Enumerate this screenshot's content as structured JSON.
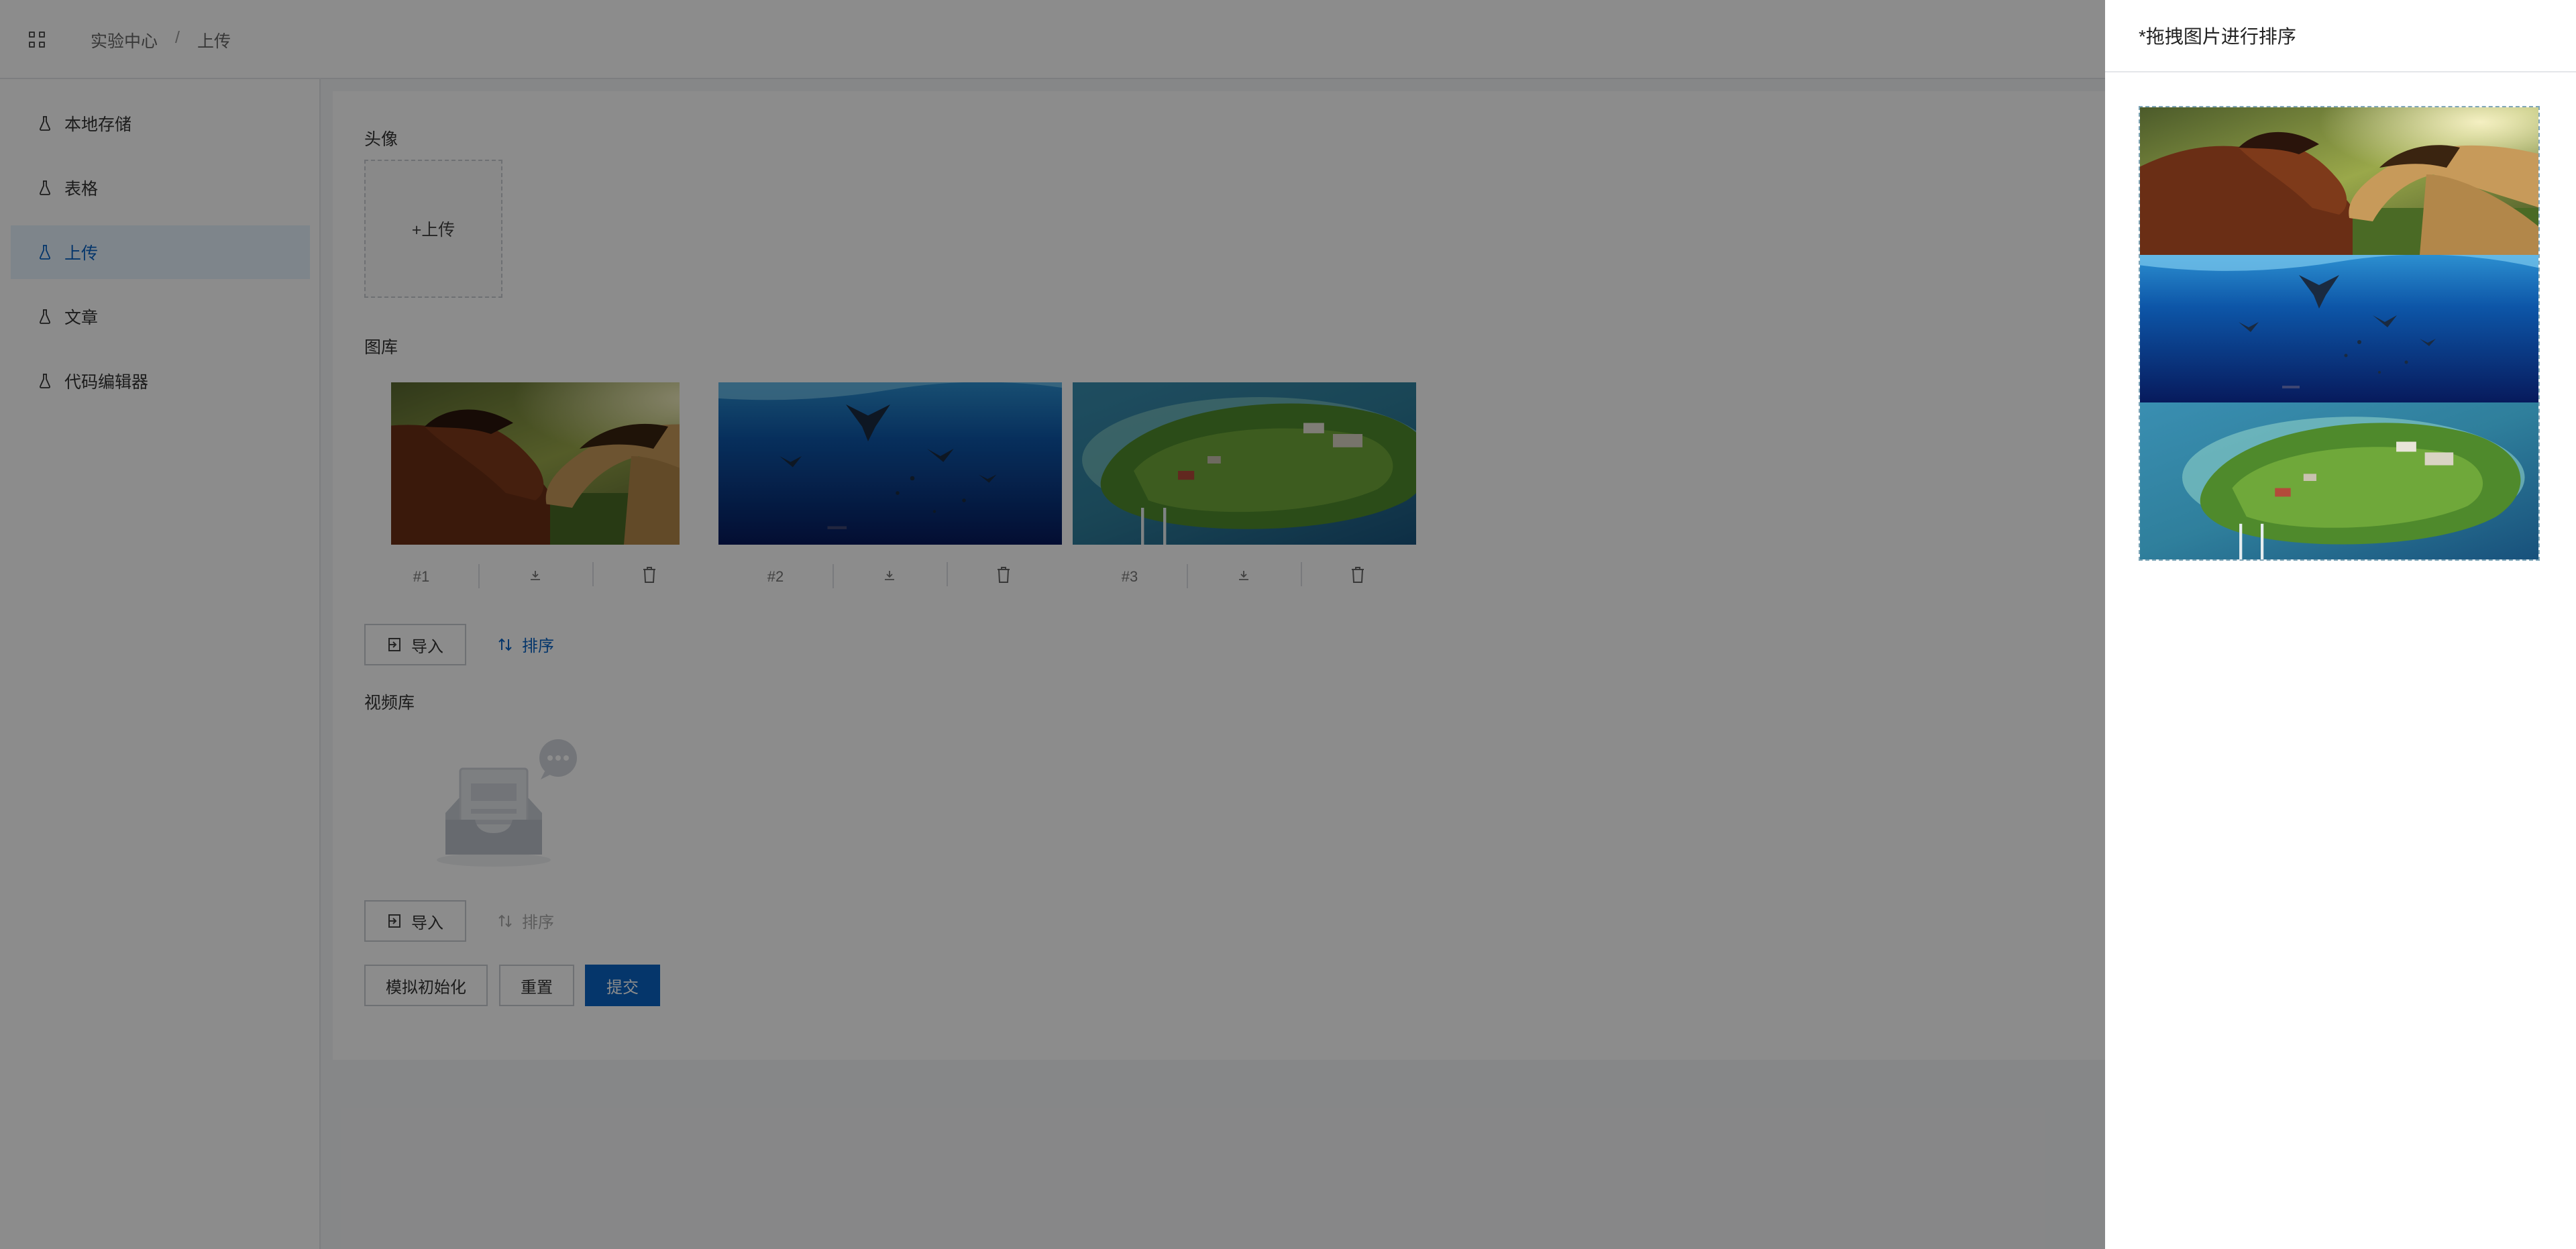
{
  "breadcrumb": {
    "root": "实验中心",
    "separator": "/",
    "current": "上传"
  },
  "sidebar": {
    "items": [
      {
        "label": "本地存储",
        "active": false
      },
      {
        "label": "表格",
        "active": false
      },
      {
        "label": "上传",
        "active": true
      },
      {
        "label": "文章",
        "active": false
      },
      {
        "label": "代码编辑器",
        "active": false
      }
    ]
  },
  "form": {
    "avatar": {
      "label": "头像",
      "upload_text": "+上传"
    },
    "gallery": {
      "label": "图库",
      "images": [
        {
          "index": "#1",
          "subject": "horses"
        },
        {
          "index": "#2",
          "subject": "manta-rays-underwater"
        },
        {
          "index": "#3",
          "subject": "aerial-island"
        }
      ],
      "import_label": "导入",
      "sort_label": "排序"
    },
    "video": {
      "label": "视频库",
      "import_label": "导入",
      "sort_label": "排序"
    },
    "buttons": {
      "mock_init": "模拟初始化",
      "reset": "重置",
      "submit": "提交"
    }
  },
  "drawer": {
    "title": "*拖拽图片进行排序",
    "items": [
      "horses",
      "manta-rays-underwater",
      "aerial-island"
    ]
  },
  "colors": {
    "primary": "#0a63c4",
    "active_bg": "#e6f2fd",
    "mask": "rgba(0,0,0,0.45)"
  }
}
